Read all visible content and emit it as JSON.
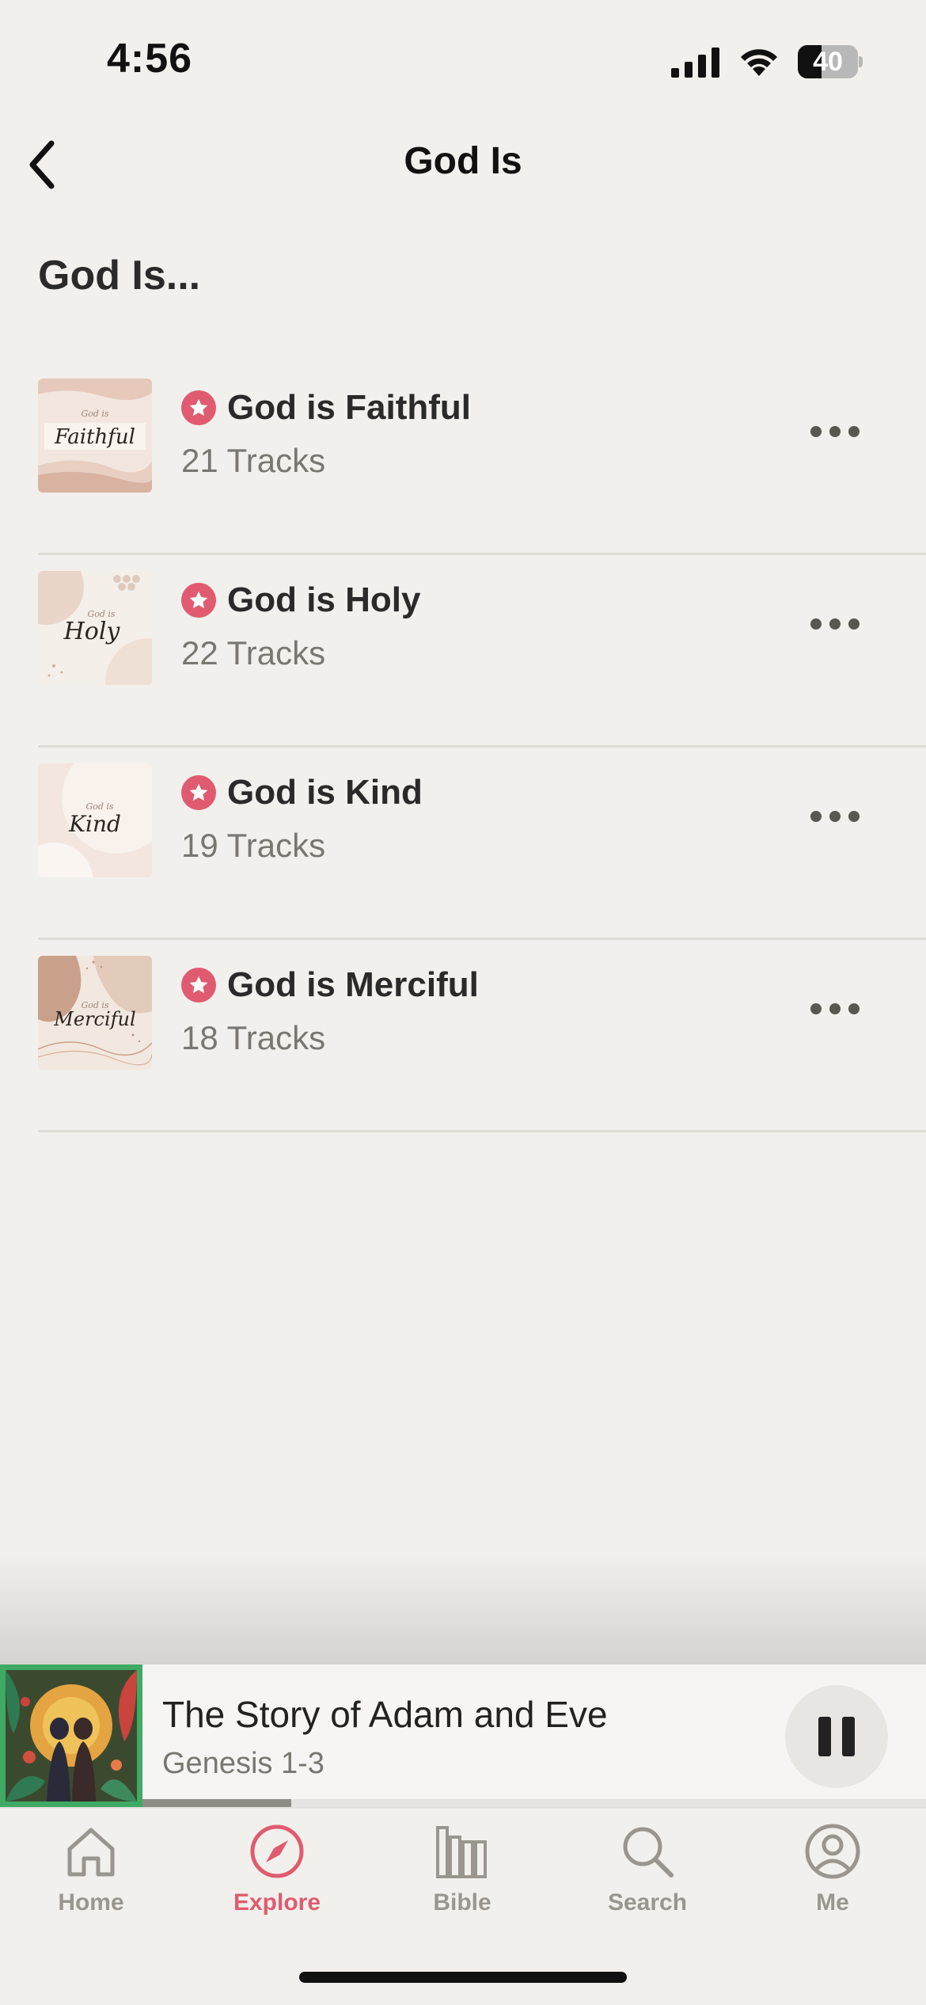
{
  "status_bar": {
    "time": "4:56",
    "battery": "40",
    "battery_level_percent": 40
  },
  "header": {
    "title": "God Is",
    "back_icon": "chevron-left-icon"
  },
  "section": {
    "title": "God Is..."
  },
  "playlists": [
    {
      "title": "God is Faithful",
      "subtitle": "21 Tracks",
      "art_word": "Faithful",
      "art_small": "God is"
    },
    {
      "title": "God is Holy",
      "subtitle": "22 Tracks",
      "art_word": "Holy",
      "art_small": "God is"
    },
    {
      "title": "God is Kind",
      "subtitle": "19 Tracks",
      "art_word": "Kind",
      "art_small": "God is"
    },
    {
      "title": "God is Merciful",
      "subtitle": "18 Tracks",
      "art_word": "Merciful",
      "art_small": "God is"
    }
  ],
  "mini_player": {
    "title": "The Story of Adam and Eve",
    "subtitle": "Genesis 1-3",
    "progress_fraction": 0.19,
    "accent_color": "#3faa63"
  },
  "tabs": [
    {
      "label": "Home",
      "icon": "home-icon",
      "active": false
    },
    {
      "label": "Explore",
      "icon": "compass-icon",
      "active": true
    },
    {
      "label": "Bible",
      "icon": "books-icon",
      "active": false
    },
    {
      "label": "Search",
      "icon": "search-icon",
      "active": false
    },
    {
      "label": "Me",
      "icon": "profile-icon",
      "active": false
    }
  ],
  "colors": {
    "accent": "#e05b6f",
    "background": "#f2f0ec",
    "muted_text": "#7a7670"
  }
}
